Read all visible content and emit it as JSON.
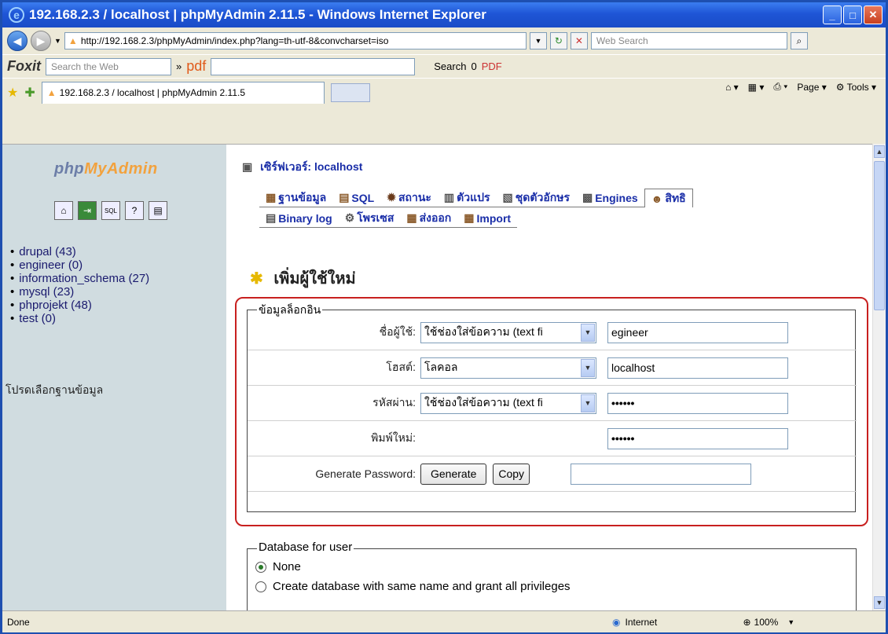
{
  "window": {
    "title": "192.168.2.3 / localhost | phpMyAdmin 2.11.5 - Windows Internet Explorer",
    "url": "http://192.168.2.3/phpMyAdmin/index.php?lang=th-utf-8&convcharset=iso",
    "web_search_placeholder": "Web Search",
    "foxit_label": "Foxit",
    "foxit_search_placeholder": "Search the Web",
    "pdf_label": "pdf",
    "search_label": "Search",
    "search_count": "0",
    "pdf_button": "PDF",
    "tab_title": "192.168.2.3 / localhost | phpMyAdmin 2.11.5",
    "page_menu": "Page",
    "tools_menu": "Tools",
    "status_text": "Done",
    "zone": "Internet",
    "zoom": "100%"
  },
  "sidebar": {
    "logo_php": "php",
    "logo_myadmin": "MyAdmin",
    "databases": [
      "drupal (43)",
      "engineer (0)",
      "information_schema (27)",
      "mysql (23)",
      "phprojekt (48)",
      "test (0)"
    ],
    "choose_db": "โปรดเลือกฐานข้อมูล"
  },
  "main": {
    "server_label": "เซิร์ฟเวอร์: localhost",
    "tabs_row1": [
      "ฐานข้อมูล",
      "SQL",
      "สถานะ",
      "ตัวแปร",
      "ชุดตัวอักษร",
      "Engines",
      "สิทธิ"
    ],
    "tabs_row2": [
      "Binary log",
      "โพรเซส",
      "ส่งออก",
      "Import"
    ],
    "heading": "เพิ่มผู้ใช้ใหม่",
    "login_legend": "ข้อมูลล็อกอิน",
    "username_label": "ชื่อผู้ใช้:",
    "username_select": "ใช้ช่องใส่ข้อความ (text fi",
    "username_value": "egineer",
    "host_label": "โฮสต์:",
    "host_select": "โลคอล",
    "host_value": "localhost",
    "password_label": "รหัสผ่าน:",
    "password_select": "ใช้ช่องใส่ข้อความ (text fi",
    "password_value": "••••••",
    "retype_label": "พิมพ์ใหม่:",
    "retype_value": "••••••",
    "generate_label": "Generate Password:",
    "generate_button": "Generate",
    "copy_button": "Copy",
    "db_legend": "Database for user",
    "radio_none": "None",
    "radio_create": "Create database with same name and grant all privileges"
  }
}
